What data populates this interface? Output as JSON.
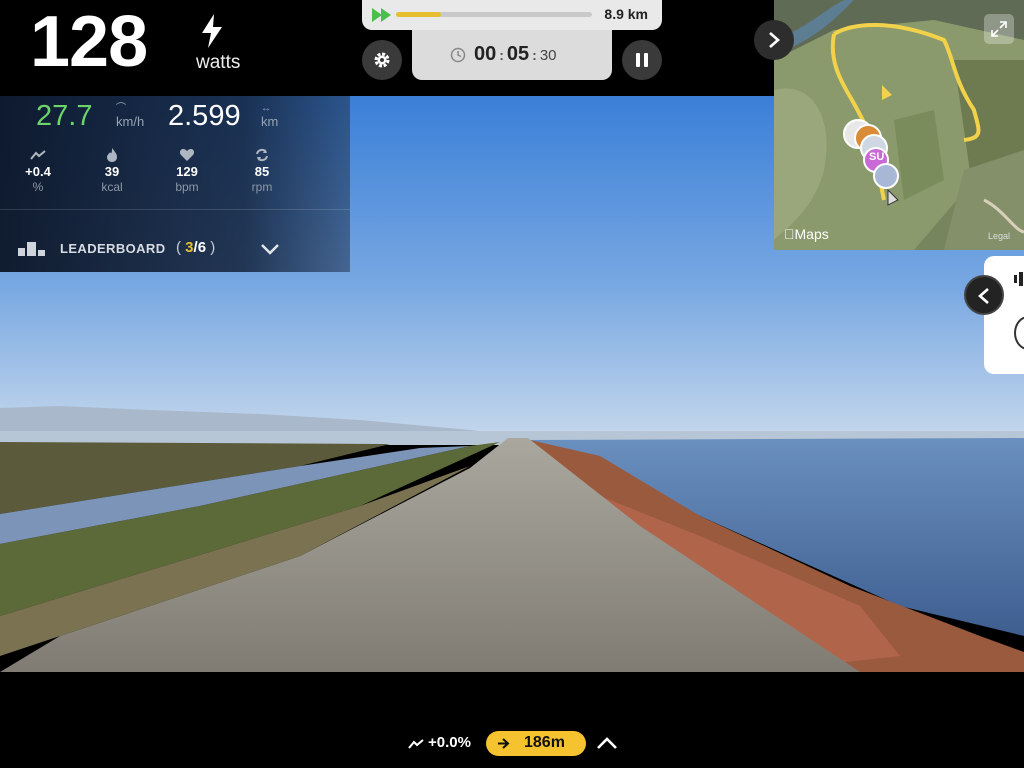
{
  "power": {
    "value": "128",
    "unit": "watts"
  },
  "course": {
    "total_distance": "8.9 km",
    "progress": 0.23
  },
  "timer": {
    "hours": "00",
    "minutes": "05",
    "seconds": "30"
  },
  "ride": {
    "speed": "27.7",
    "speed_unit": "km/h",
    "distance": "2.599",
    "distance_unit": "km"
  },
  "metrics": [
    {
      "icon": "slope-icon",
      "value": "+0.4",
      "unit": "%"
    },
    {
      "icon": "flame-icon",
      "value": "39",
      "unit": "kcal"
    },
    {
      "icon": "heart-icon",
      "value": "129",
      "unit": "bpm"
    },
    {
      "icon": "cadence-icon",
      "value": "85",
      "unit": "rpm"
    }
  ],
  "leaderboard": {
    "label": "LEADERBOARD",
    "open": "(",
    "position": "3",
    "slash": "/",
    "total": "6",
    "close": ")"
  },
  "map": {
    "attribution": "Maps",
    "legal": "Legal",
    "avatar_initials": "SU"
  },
  "bottom": {
    "grade": "+0.0%",
    "next_distance": "186m"
  },
  "colors": {
    "accent": "#f4c32f",
    "speed": "#6ad46a",
    "route": "#f2d24a"
  }
}
